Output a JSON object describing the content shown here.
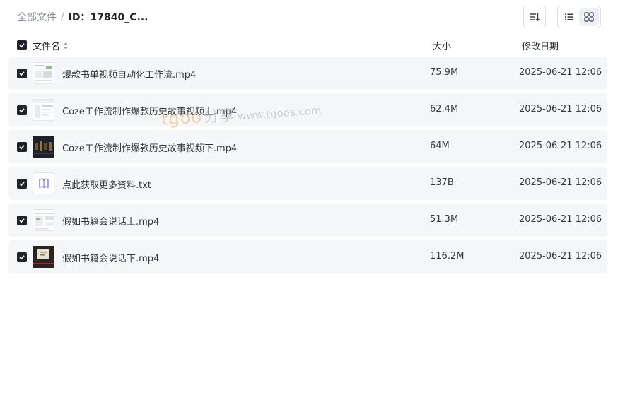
{
  "breadcrumb": {
    "root": "全部文件",
    "separator": "/",
    "current": "ID：17840_C..."
  },
  "toolbar": {
    "sort_icon": "sort-icon",
    "list_icon": "list-view-icon",
    "grid_icon": "grid-view-icon"
  },
  "columns": {
    "name": "文件名",
    "size": "大小",
    "date": "修改日期"
  },
  "files": [
    {
      "name": "爆款书单视频自动化工作流.mp4",
      "size": "75.9M",
      "date": "2025-06-21 12:06",
      "thumb": "video-thumbnail-light"
    },
    {
      "name": "Coze工作流制作爆款历史故事视频上.mp4",
      "size": "62.4M",
      "date": "2025-06-21 12:06",
      "thumb": "video-thumbnail-light"
    },
    {
      "name": "Coze工作流制作爆款历史故事视频下.mp4",
      "size": "64M",
      "date": "2025-06-21 12:06",
      "thumb": "video-thumbnail-dark"
    },
    {
      "name": "点此获取更多资料.txt",
      "size": "137B",
      "date": "2025-06-21 12:06",
      "thumb": "document-icon"
    },
    {
      "name": "假如书籍会说话上.mp4",
      "size": "51.3M",
      "date": "2025-06-21 12:06",
      "thumb": "video-thumbnail-light"
    },
    {
      "name": "假如书籍会说话下.mp4",
      "size": "116.2M",
      "date": "2025-06-21 12:06",
      "thumb": "video-thumbnail-dark"
    }
  ],
  "watermark": {
    "brand": "tgoo",
    "cn": "分享",
    "url": "www.tgoos.com"
  },
  "colors": {
    "row_bg": "#f5f6f7",
    "checkbox": "#1f2329",
    "accent_watermark": "#f0a24a"
  }
}
